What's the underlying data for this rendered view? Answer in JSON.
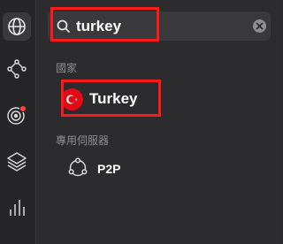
{
  "sidebar": {
    "items": [
      {
        "icon": "globe-icon",
        "active": true
      },
      {
        "icon": "network-icon",
        "active": false
      },
      {
        "icon": "radar-icon",
        "active": false,
        "badge_color": "#ff453a"
      },
      {
        "icon": "layers-icon",
        "active": false
      },
      {
        "icon": "stats-icon",
        "active": false
      }
    ]
  },
  "search": {
    "value": "turkey",
    "placeholder": ""
  },
  "results": {
    "countries_label": "國家",
    "countries": [
      {
        "name": "Turkey",
        "flag_color": "#e30a17"
      }
    ],
    "servers_label": "專用伺服器",
    "servers": [
      {
        "name": "P2P",
        "icon": "p2p-icon"
      }
    ]
  },
  "colors": {
    "highlight": "#ff1a1a",
    "background": "#2c2c2e"
  }
}
